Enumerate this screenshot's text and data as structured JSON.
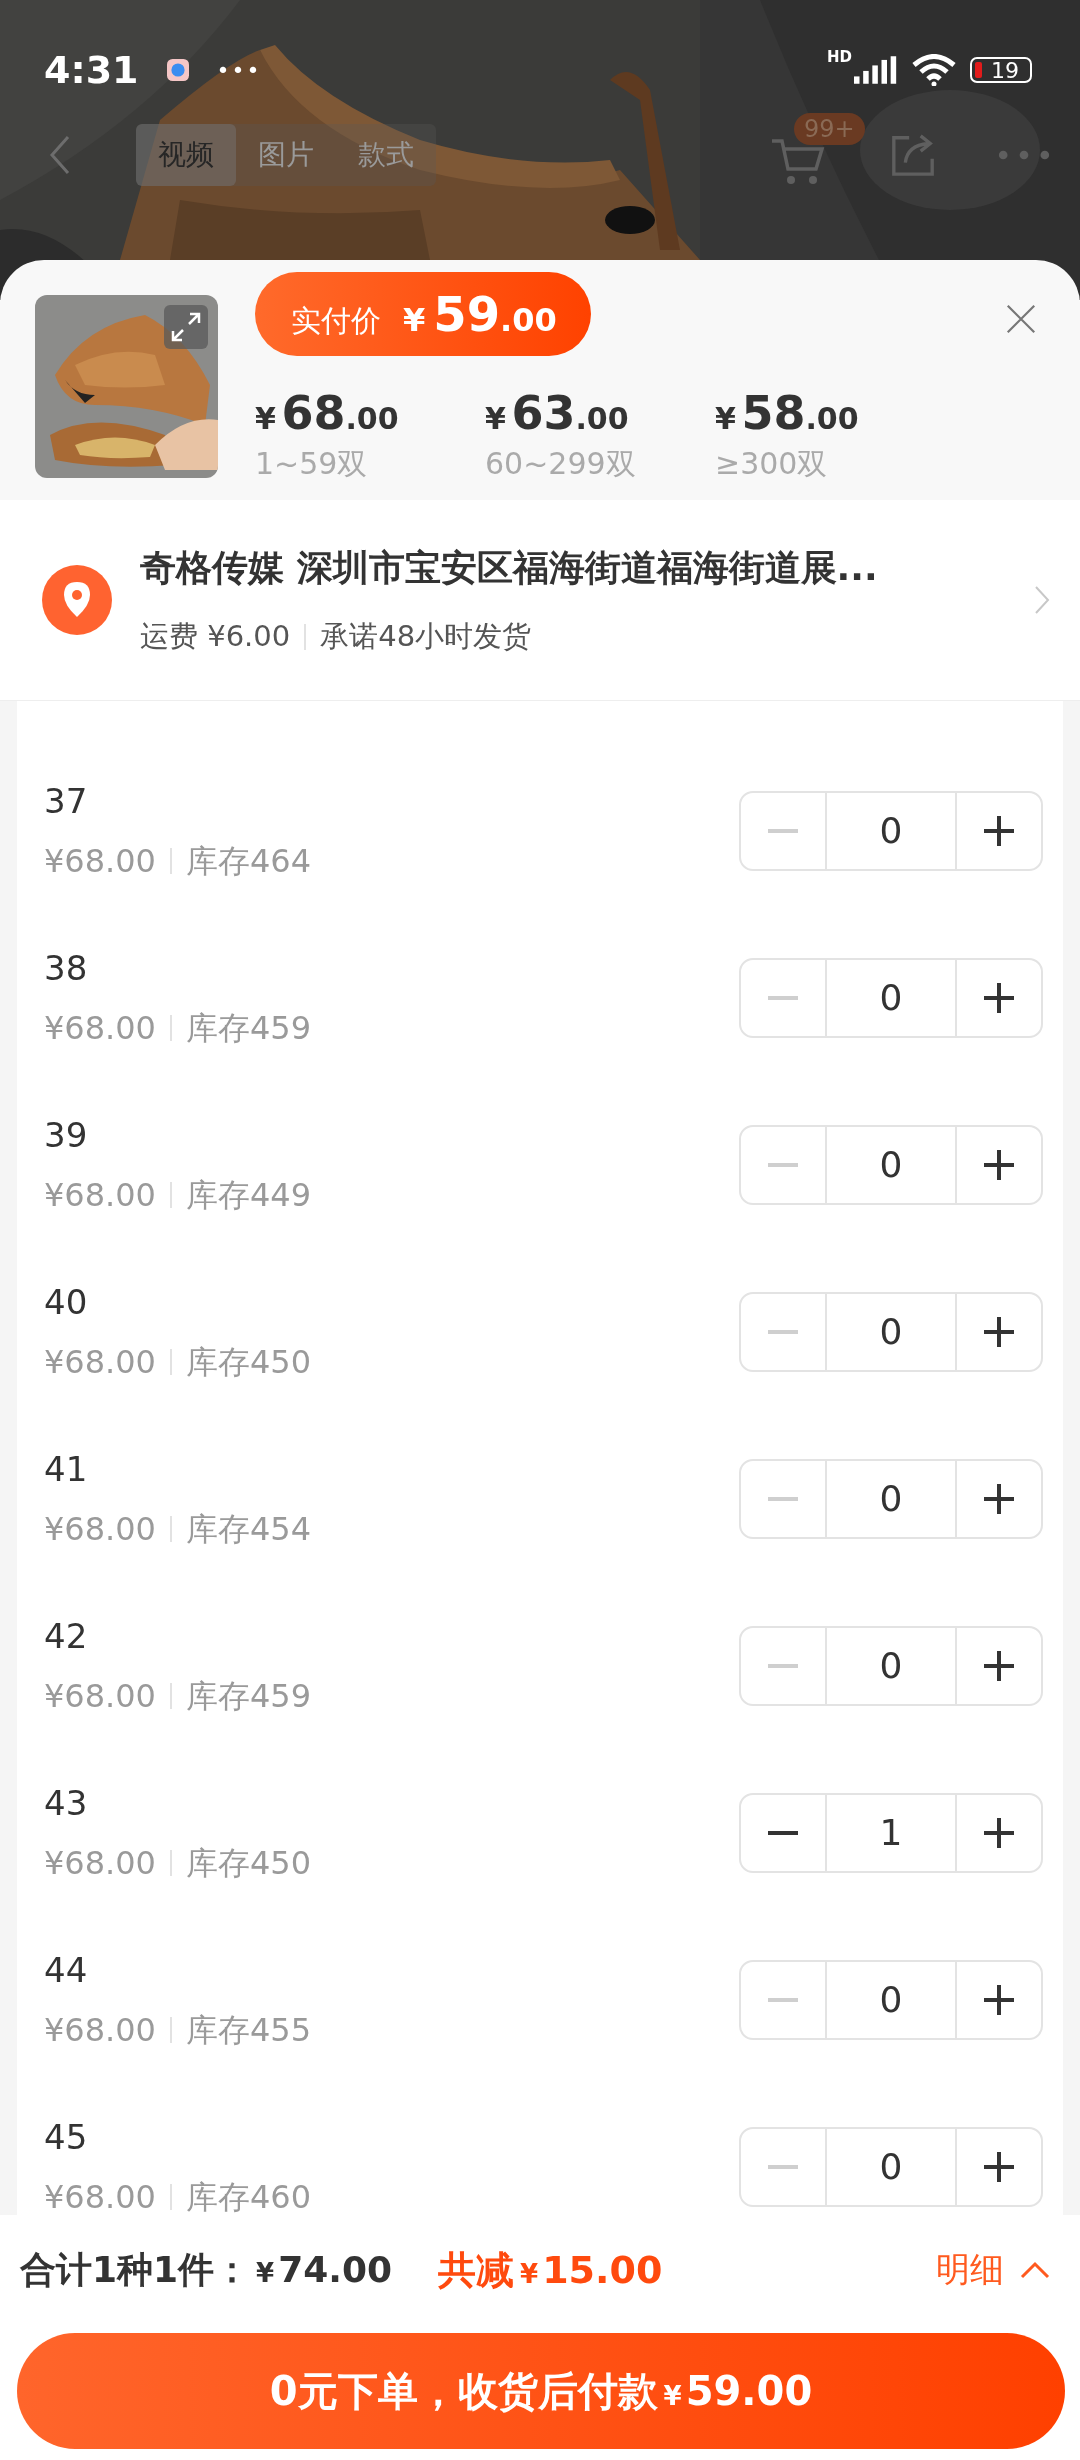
{
  "status_bar": {
    "time": "4:31",
    "more": "•••",
    "network": "HD",
    "battery": "19"
  },
  "nav": {
    "tabs": [
      {
        "label": "视频",
        "selected": true
      },
      {
        "label": "图片",
        "selected": false
      },
      {
        "label": "款式",
        "selected": false
      }
    ],
    "cart_badge": "99+"
  },
  "sku_panel": {
    "actual_price": {
      "label": "实付价",
      "currency": "¥",
      "integer": "59",
      "decimal": ".00"
    },
    "tiers": [
      {
        "currency": "¥",
        "integer": "68",
        "decimal": ".00",
        "range": "1~59双"
      },
      {
        "currency": "¥",
        "integer": "63",
        "decimal": ".00",
        "range": "60~299双"
      },
      {
        "currency": "¥",
        "integer": "58",
        "decimal": ".00",
        "range": "≥300双"
      }
    ]
  },
  "address": {
    "text": "奇格传媒 深圳市宝安区福海街道福海街道展...",
    "shipping": "运费 ¥6.00",
    "promise": "承诺48小时发货"
  },
  "sizes": [
    {
      "size": "37",
      "price": "¥68.00",
      "stock": "库存464",
      "quantity": "0",
      "minus_enabled": false
    },
    {
      "size": "38",
      "price": "¥68.00",
      "stock": "库存459",
      "quantity": "0",
      "minus_enabled": false
    },
    {
      "size": "39",
      "price": "¥68.00",
      "stock": "库存449",
      "quantity": "0",
      "minus_enabled": false
    },
    {
      "size": "40",
      "price": "¥68.00",
      "stock": "库存450",
      "quantity": "0",
      "minus_enabled": false
    },
    {
      "size": "41",
      "price": "¥68.00",
      "stock": "库存454",
      "quantity": "0",
      "minus_enabled": false
    },
    {
      "size": "42",
      "price": "¥68.00",
      "stock": "库存459",
      "quantity": "0",
      "minus_enabled": false
    },
    {
      "size": "43",
      "price": "¥68.00",
      "stock": "库存450",
      "quantity": "1",
      "minus_enabled": true
    },
    {
      "size": "44",
      "price": "¥68.00",
      "stock": "库存455",
      "quantity": "0",
      "minus_enabled": false
    },
    {
      "size": "45",
      "price": "¥68.00",
      "stock": "库存460",
      "quantity": "0",
      "minus_enabled": false
    }
  ],
  "footer": {
    "total_label": "合计1种1件：",
    "total_currency": "¥",
    "total_amount": "74.00",
    "discount_label": "共减",
    "discount_currency": "¥",
    "discount_amount": "15.00",
    "details": "明细",
    "submit": {
      "text": "0元下单，收货后付款",
      "currency": "¥",
      "amount": "59.00"
    }
  }
}
